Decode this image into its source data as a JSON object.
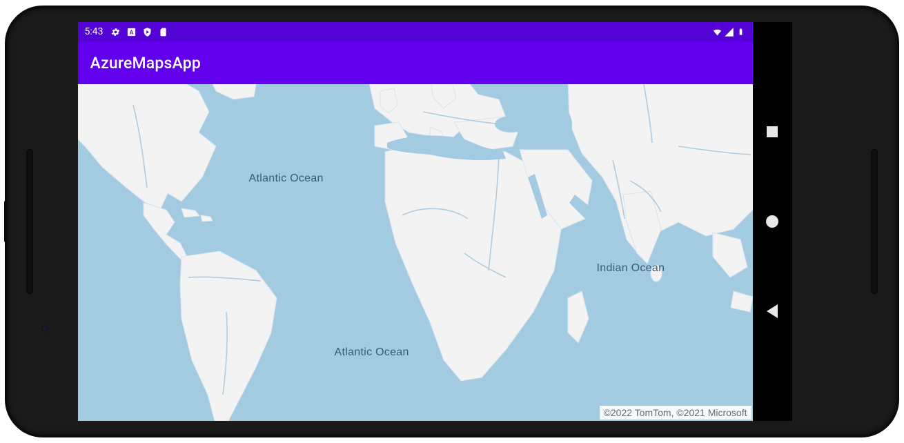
{
  "status_bar": {
    "time": "5:43",
    "icons_left": [
      "gear",
      "a-box",
      "shield",
      "sd-card"
    ],
    "icons_right": [
      "wifi",
      "signal",
      "battery"
    ]
  },
  "app_bar": {
    "title": "AzureMapsApp",
    "color": "#6200ee"
  },
  "map": {
    "ocean_color": "#a2cbe2",
    "land_color": "#f3f3f4",
    "river_color": "#b0ccdc",
    "label_color": "#3a5a72",
    "labels": {
      "atlantic_n": "Atlantic Ocean",
      "atlantic_s": "Atlantic Ocean",
      "indian": "Indian Ocean"
    },
    "attribution": "©2022 TomTom, ©2021 Microsoft"
  },
  "nav": {
    "recent": "recent-apps",
    "home": "home",
    "back": "back"
  }
}
